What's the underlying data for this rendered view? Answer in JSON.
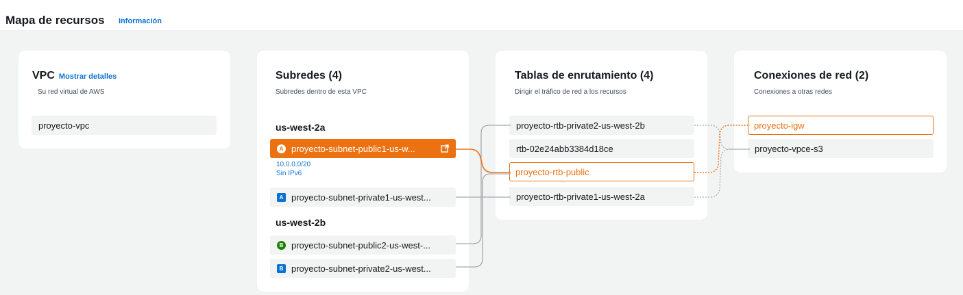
{
  "header": {
    "title": "Mapa de recursos",
    "info_link": "Información"
  },
  "vpc": {
    "title": "VPC",
    "details_link": "Mostrar detalles",
    "subtitle": "Su red virtual de AWS",
    "item": "proyecto-vpc"
  },
  "subnets": {
    "title": "Subredes (4)",
    "subtitle": "Subredes dentro de esta VPC",
    "zones": [
      {
        "name": "us-west-2a",
        "items": [
          {
            "badge": "A",
            "label": "proyecto-subnet-public1-us-w...",
            "cidr": "10.0.0.0/20",
            "ipv6": "Sin IPv6"
          },
          {
            "badge": "A",
            "label": "proyecto-subnet-private1-us-west..."
          }
        ]
      },
      {
        "name": "us-west-2b",
        "items": [
          {
            "badge": "B",
            "label": "proyecto-subnet-public2-us-west-..."
          },
          {
            "badge": "B",
            "label": "proyecto-subnet-private2-us-west..."
          }
        ]
      }
    ]
  },
  "route_tables": {
    "title": "Tablas de enrutamiento (4)",
    "subtitle": "Dirigir el tráfico de red a los recursos",
    "items": [
      "proyecto-rtb-private2-us-west-2b",
      "rtb-02e24abb3384d18ce",
      "proyecto-rtb-public",
      "proyecto-rtb-private1-us-west-2a"
    ]
  },
  "network_connections": {
    "title": "Conexiones de red (2)",
    "subtitle": "Conexiones a otras redes",
    "items": [
      "proyecto-igw",
      "proyecto-vpce-s3"
    ]
  },
  "colors": {
    "accent": "#ec7211",
    "link": "#0972d3",
    "badge_private": "#0972d3",
    "badge_public": "#1d8102",
    "canvas": "#f2f3f3"
  }
}
